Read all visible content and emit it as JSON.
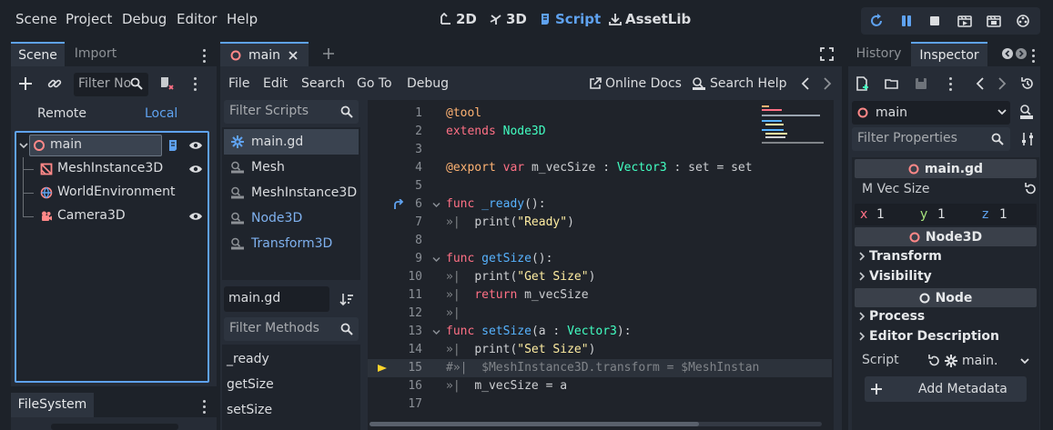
{
  "menu": [
    "Scene",
    "Project",
    "Debug",
    "Editor",
    "Help"
  ],
  "workspaces": [
    {
      "label": "2D",
      "icon": "2d-icon"
    },
    {
      "label": "3D",
      "icon": "3d-icon"
    },
    {
      "label": "Script",
      "icon": "script-icon",
      "active": true
    },
    {
      "label": "AssetLib",
      "icon": "assetlib-icon"
    }
  ],
  "scene_dock": {
    "tabs": [
      "Scene",
      "Import"
    ],
    "filter_placeholder": "Filter No",
    "remote_label": "Remote",
    "local_label": "Local",
    "nodes": [
      {
        "name": "main",
        "icon": "node-icon",
        "depth": 0,
        "selected": true,
        "script": true,
        "visible": true
      },
      {
        "name": "MeshInstance3D",
        "icon": "mesh-instance-icon",
        "depth": 1,
        "visible": true
      },
      {
        "name": "WorldEnvironment",
        "icon": "world-environment-icon",
        "depth": 1
      },
      {
        "name": "Camera3D",
        "icon": "camera-icon",
        "depth": 1,
        "visible": true
      }
    ]
  },
  "filesystem_dock": {
    "tab": "FileSystem"
  },
  "script_editor": {
    "open_tab": "main",
    "menu": [
      "File",
      "Edit",
      "Search",
      "Go To",
      "Debug"
    ],
    "online_docs_label": "Online Docs",
    "search_help_label": "Search Help",
    "filter_scripts_placeholder": "Filter Scripts",
    "scripts": [
      {
        "name": "main.gd",
        "selected": true,
        "kind": "script"
      },
      {
        "name": "Mesh",
        "kind": "doc"
      },
      {
        "name": "MeshInstance3D",
        "kind": "doc"
      },
      {
        "name": "Node3D",
        "kind": "doc",
        "link": true
      },
      {
        "name": "Transform3D",
        "kind": "doc",
        "link": true
      }
    ],
    "current_file": "main.gd",
    "filter_methods_placeholder": "Filter Methods",
    "methods": [
      "_ready",
      "getSize",
      "setSize"
    ],
    "code_lines": [
      {
        "n": "1",
        "tokens": [
          [
            "ann",
            "@tool"
          ]
        ]
      },
      {
        "n": "2",
        "tokens": [
          [
            "kw",
            "extends "
          ],
          [
            "ty",
            "Node3D"
          ]
        ]
      },
      {
        "n": "3",
        "tokens": []
      },
      {
        "n": "4",
        "tokens": [
          [
            "ann",
            "@export "
          ],
          [
            "kw",
            "var "
          ],
          [
            "plain",
            "m_vecSize : "
          ],
          [
            "ty",
            "Vector3"
          ],
          [
            "plain",
            " : set = set"
          ]
        ]
      },
      {
        "n": "5",
        "tokens": []
      },
      {
        "n": "6",
        "fold": true,
        "marker": "override",
        "tokens": [
          [
            "kw",
            "func "
          ],
          [
            "fn",
            "_ready"
          ],
          [
            "plain",
            "():"
          ]
        ]
      },
      {
        "n": "7",
        "indent": true,
        "tokens": [
          [
            "plain",
            "print("
          ],
          [
            "str",
            "\"Ready\""
          ],
          [
            "plain",
            ")"
          ]
        ]
      },
      {
        "n": "8",
        "tokens": []
      },
      {
        "n": "9",
        "fold": true,
        "tokens": [
          [
            "kw",
            "func "
          ],
          [
            "fn",
            "getSize"
          ],
          [
            "plain",
            "():"
          ]
        ]
      },
      {
        "n": "10",
        "indent": true,
        "tokens": [
          [
            "plain",
            "print("
          ],
          [
            "str",
            "\"Get Size\""
          ],
          [
            "plain",
            ")"
          ]
        ]
      },
      {
        "n": "11",
        "indent": true,
        "tokens": [
          [
            "kw",
            "return "
          ],
          [
            "plain",
            "m_vecSize"
          ]
        ]
      },
      {
        "n": "12",
        "indent": true,
        "tokens": []
      },
      {
        "n": "13",
        "fold": true,
        "tokens": [
          [
            "kw",
            "func "
          ],
          [
            "fn",
            "setSize"
          ],
          [
            "plain",
            "(a : "
          ],
          [
            "ty",
            "Vector3"
          ],
          [
            "plain",
            "):"
          ]
        ]
      },
      {
        "n": "14",
        "indent": true,
        "tokens": [
          [
            "plain",
            "print("
          ],
          [
            "str",
            "\"Set Size\""
          ],
          [
            "plain",
            ")"
          ]
        ]
      },
      {
        "n": "15",
        "current": true,
        "marker": "execution",
        "tokens": [
          [
            "cmt",
            "#"
          ],
          [
            "cmt",
            "»|  $MeshInstance3D.transform = $MeshInstan"
          ]
        ]
      },
      {
        "n": "16",
        "indent": true,
        "tokens": [
          [
            "plain",
            "m_vecSize = a"
          ]
        ]
      },
      {
        "n": "17",
        "tokens": []
      }
    ]
  },
  "inspector": {
    "tabs": [
      "History",
      "Inspector"
    ],
    "object_name": "main",
    "filter_placeholder": "Filter Properties",
    "script_section": "main.gd",
    "property_label": "M Vec Size",
    "vector": {
      "x": "1",
      "y": "1",
      "z": "1"
    },
    "node3d_section": "Node3D",
    "node3d_groups": [
      "Transform",
      "Visibility"
    ],
    "node_section": "Node",
    "node_groups": [
      "Process",
      "Editor Description"
    ],
    "script_label": "Script",
    "script_value": "main.",
    "add_metadata_label": "Add Metadata"
  },
  "colors": {
    "accent": "#5fa2ef",
    "node_red": "#ff8888",
    "background": "#1d2229",
    "panel": "#262c36"
  }
}
